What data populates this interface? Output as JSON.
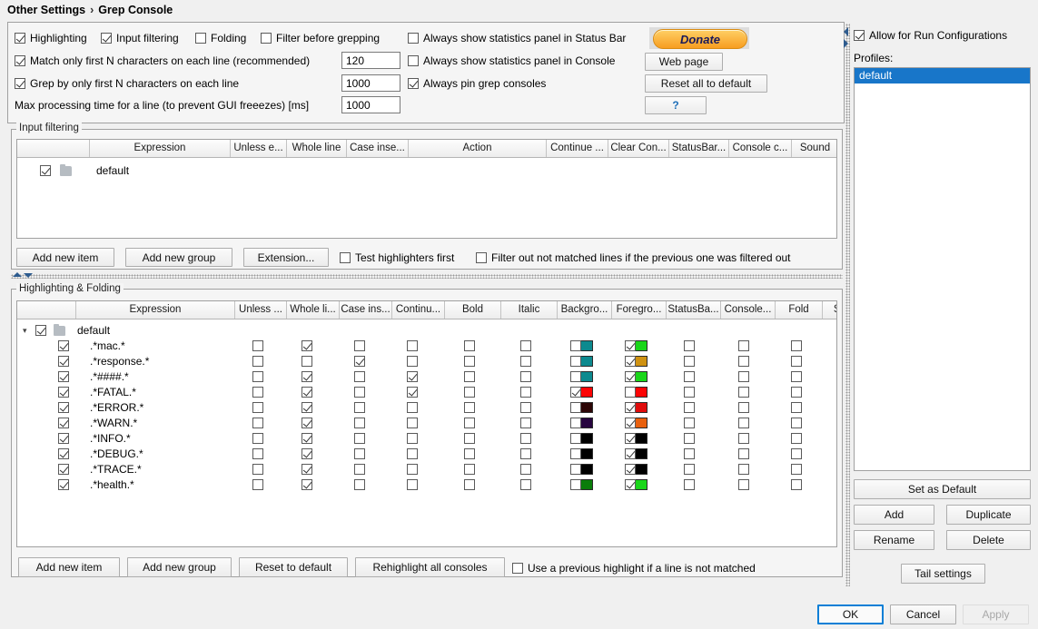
{
  "breadcrumb": {
    "parent": "Other Settings",
    "separator": "›",
    "current": "Grep Console"
  },
  "top_options": {
    "row1": [
      {
        "label": "Highlighting",
        "checked": true
      },
      {
        "label": "Input filtering",
        "checked": true
      },
      {
        "label": "Folding",
        "checked": false
      },
      {
        "label": "Filter before grepping",
        "checked": false
      },
      {
        "label": "Always show statistics panel in Status Bar",
        "checked": false
      }
    ],
    "row2": {
      "label": "Match only first N characters on each line (recommended)",
      "checked": true,
      "value": "120",
      "right": {
        "label": "Always show statistics panel in Console",
        "checked": false
      }
    },
    "row3": {
      "label": "Grep by only first N characters on each line",
      "checked": true,
      "value": "1000",
      "right": {
        "label": "Always pin grep consoles",
        "checked": true
      }
    },
    "row4": {
      "label": "Max processing time for a line (to prevent GUI freeezes) [ms]",
      "value": "1000"
    },
    "buttons": {
      "donate": "Donate",
      "web_page": "Web page",
      "reset_all": "Reset all to default",
      "help": "?"
    }
  },
  "input_filtering": {
    "title": "Input filtering",
    "columns": [
      "",
      "Expression",
      "Unless e...",
      "Whole line",
      "Case inse...",
      "Action",
      "Continue ...",
      "Clear Con...",
      "StatusBar...",
      "Console c...",
      "Sound"
    ],
    "rows": [
      {
        "type": "group",
        "enabled": true,
        "expression": "default"
      }
    ],
    "footer": {
      "add_item": "Add new item",
      "add_group": "Add new group",
      "extension": "Extension...",
      "test_highlighters": {
        "label": "Test highlighters first",
        "checked": false
      },
      "filter_out": {
        "label": "Filter out not matched lines if the previous one was filtered out",
        "checked": false
      }
    }
  },
  "highlighting": {
    "title": "Highlighting & Folding",
    "columns": [
      "",
      "Expression",
      "Unless ...",
      "Whole li...",
      "Case ins...",
      "Continu...",
      "Bold",
      "Italic",
      "Backgro...",
      "Foregro...",
      "StatusBa...",
      "Console...",
      "Fold",
      "Sound"
    ],
    "group": {
      "enabled": true,
      "expression": "default"
    },
    "rows": [
      {
        "expression": ".*mac.*",
        "enabled": true,
        "unless": false,
        "whole_line": true,
        "case_ins": false,
        "continue": false,
        "bold": false,
        "italic": false,
        "bg_on": false,
        "bg_color": "#0d8a8f",
        "fg_on": true,
        "fg_color": "#19d619",
        "statusbar": false,
        "console": false,
        "fold": false,
        "sound": "speaker-icon"
      },
      {
        "expression": ".*response.*",
        "enabled": true,
        "unless": false,
        "whole_line": false,
        "case_ins": true,
        "continue": false,
        "bold": false,
        "italic": false,
        "bg_on": false,
        "bg_color": "#0d8a8f",
        "fg_on": true,
        "fg_color": "#cf9212",
        "statusbar": false,
        "console": false,
        "fold": false,
        "sound": "speaker-icon"
      },
      {
        "expression": ".*####.*",
        "enabled": true,
        "unless": false,
        "whole_line": true,
        "case_ins": false,
        "continue": true,
        "bold": false,
        "italic": false,
        "bg_on": false,
        "bg_color": "#0d8a8f",
        "fg_on": true,
        "fg_color": "#19d619",
        "statusbar": false,
        "console": false,
        "fold": false,
        "sound": "speaker-icon"
      },
      {
        "expression": ".*FATAL.*",
        "enabled": true,
        "unless": false,
        "whole_line": true,
        "case_ins": false,
        "continue": true,
        "bold": false,
        "italic": false,
        "bg_on": true,
        "bg_color": "#fc0505",
        "fg_on": false,
        "fg_color": "#fc0505",
        "statusbar": false,
        "console": false,
        "fold": false,
        "sound": "speaker-icon"
      },
      {
        "expression": ".*ERROR.*",
        "enabled": true,
        "unless": false,
        "whole_line": true,
        "case_ins": false,
        "continue": false,
        "bold": false,
        "italic": false,
        "bg_on": false,
        "bg_color": "#2d0606",
        "fg_on": true,
        "fg_color": "#e00d0d",
        "statusbar": false,
        "console": false,
        "fold": false,
        "sound": "speaker-icon"
      },
      {
        "expression": ".*WARN.*",
        "enabled": true,
        "unless": false,
        "whole_line": true,
        "case_ins": false,
        "continue": false,
        "bold": false,
        "italic": false,
        "bg_on": false,
        "bg_color": "#27053f",
        "fg_on": true,
        "fg_color": "#e8600e",
        "statusbar": false,
        "console": false,
        "fold": false,
        "sound": "speaker-icon"
      },
      {
        "expression": ".*INFO.*",
        "enabled": true,
        "unless": false,
        "whole_line": true,
        "case_ins": false,
        "continue": false,
        "bold": false,
        "italic": false,
        "bg_on": false,
        "bg_color": "#000000",
        "fg_on": true,
        "fg_color": "#000000",
        "statusbar": false,
        "console": false,
        "fold": false,
        "sound": "speaker-icon"
      },
      {
        "expression": ".*DEBUG.*",
        "enabled": true,
        "unless": false,
        "whole_line": true,
        "case_ins": false,
        "continue": false,
        "bold": false,
        "italic": false,
        "bg_on": false,
        "bg_color": "#000000",
        "fg_on": true,
        "fg_color": "#000000",
        "statusbar": false,
        "console": false,
        "fold": false,
        "sound": "speaker-icon"
      },
      {
        "expression": ".*TRACE.*",
        "enabled": true,
        "unless": false,
        "whole_line": true,
        "case_ins": false,
        "continue": false,
        "bold": false,
        "italic": false,
        "bg_on": false,
        "bg_color": "#000000",
        "fg_on": true,
        "fg_color": "#000000",
        "statusbar": false,
        "console": false,
        "fold": false,
        "sound": "speaker-icon"
      },
      {
        "expression": ".*health.*",
        "enabled": true,
        "unless": false,
        "whole_line": true,
        "case_ins": false,
        "continue": false,
        "bold": false,
        "italic": false,
        "bg_on": false,
        "bg_color": "#0a7d0a",
        "fg_on": true,
        "fg_color": "#19d619",
        "statusbar": false,
        "console": false,
        "fold": false,
        "sound": "speaker-icon"
      }
    ],
    "footer": {
      "add_item": "Add new item",
      "add_group": "Add new group",
      "reset": "Reset to default",
      "rehighlight": "Rehighlight all consoles",
      "use_previous": {
        "label": "Use a previous highlight if a line is not matched",
        "checked": false
      }
    }
  },
  "sidebar": {
    "allow_run_configs": {
      "label": "Allow for Run Configurations",
      "checked": true
    },
    "profiles_label": "Profiles:",
    "profiles": [
      {
        "name": "default",
        "selected": true
      }
    ],
    "buttons": {
      "set_default": "Set as Default",
      "add": "Add",
      "duplicate": "Duplicate",
      "rename": "Rename",
      "delete": "Delete",
      "tail_settings": "Tail settings"
    }
  },
  "dialog_buttons": {
    "ok": "OK",
    "cancel": "Cancel",
    "apply": "Apply"
  },
  "accent": "#1876c9"
}
